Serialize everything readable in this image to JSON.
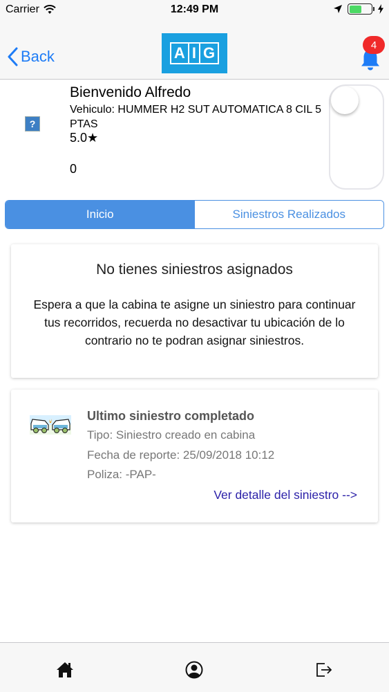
{
  "status_bar": {
    "carrier": "Carrier",
    "time": "12:49 PM",
    "battery_level": 0.55,
    "battery_color": "#4cd964"
  },
  "nav": {
    "back_label": "Back",
    "logo_letters": [
      "A",
      "I",
      "G"
    ],
    "logo_color": "#1aa0e0",
    "notification_count": "4",
    "accent_color": "#1e7cf6"
  },
  "profile": {
    "avatar_glyph": "?",
    "welcome": "Bienvenido Alfredo",
    "vehicle": "Vehiculo: HUMMER H2 SUT AUTOMATICA 8 CIL 5 PTAS",
    "rating": "5.0★",
    "count": "0",
    "availability_toggle_on": false
  },
  "tabs": [
    {
      "label": "Inicio",
      "active": true
    },
    {
      "label": "Siniestros Realizados",
      "active": false
    }
  ],
  "empty_card": {
    "title": "No tienes siniestros asignados",
    "body": "Espera a que la cabina te asigne un siniestro para continuar tus recorridos, recuerda no desactivar tu ubicación de lo contrario no te podran asignar siniestros."
  },
  "last_card": {
    "title": "Ultimo siniestro completado",
    "tipo": "Tipo: Siniestro creado en cabina",
    "fecha": "Fecha de reporte: 25/09/2018 10:12",
    "poliza": "Poliza: -PAP-",
    "link": "Ver detalle del siniestro -->"
  },
  "tab_bar": {
    "icons": [
      "home-icon",
      "profile-icon",
      "logout-icon"
    ]
  }
}
